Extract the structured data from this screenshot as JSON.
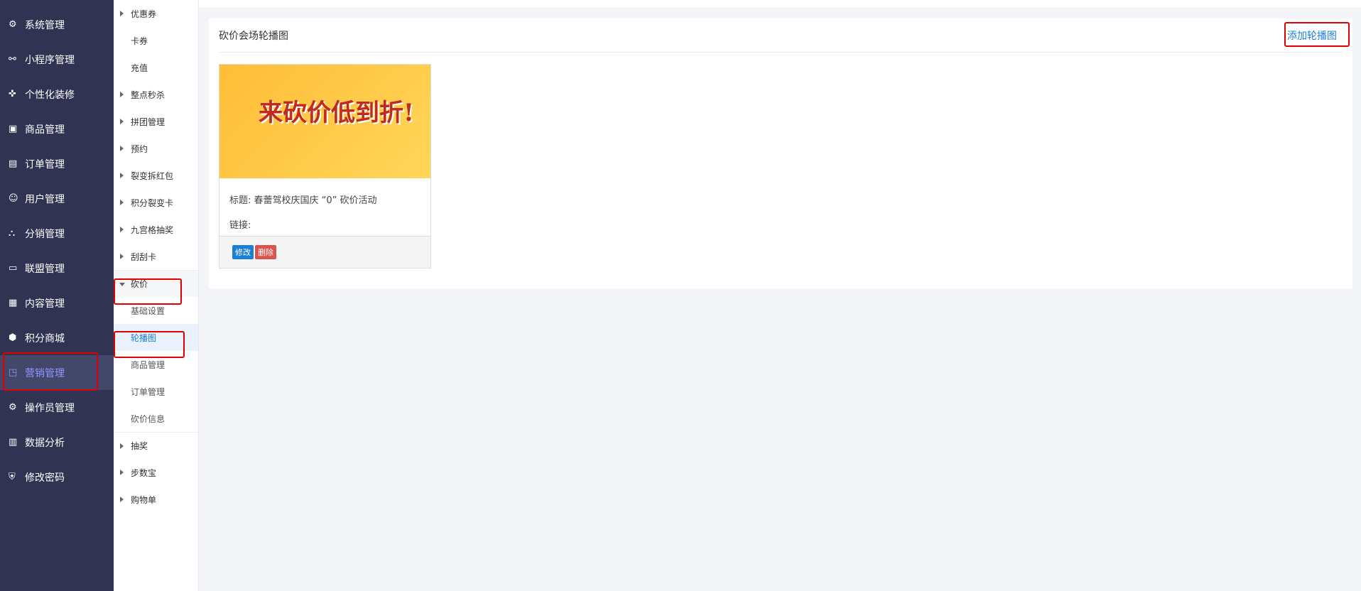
{
  "nav": [
    {
      "icon": "⚙",
      "label": "系统管理"
    },
    {
      "icon": "⚯",
      "label": "小程序管理"
    },
    {
      "icon": "✜",
      "label": "个性化装修"
    },
    {
      "icon": "▣",
      "label": "商品管理"
    },
    {
      "icon": "▤",
      "label": "订单管理"
    },
    {
      "icon": "☺",
      "label": "用户管理"
    },
    {
      "icon": "⛬",
      "label": "分销管理"
    },
    {
      "icon": "▭",
      "label": "联盟管理"
    },
    {
      "icon": "▦",
      "label": "内容管理"
    },
    {
      "icon": "⬢",
      "label": "积分商城"
    },
    {
      "icon": "◳",
      "label": "营销管理",
      "active": true
    },
    {
      "icon": "⚙",
      "label": "操作员管理"
    },
    {
      "icon": "▥",
      "label": "数据分析"
    },
    {
      "icon": "⛨",
      "label": "修改密码"
    }
  ],
  "sub": [
    {
      "l": "优惠券",
      "a": 1
    },
    {
      "l": "卡券"
    },
    {
      "l": "充值"
    },
    {
      "l": "整点秒杀",
      "a": 1
    },
    {
      "l": "拼团管理",
      "a": 1
    },
    {
      "l": "预约",
      "a": 1
    },
    {
      "l": "裂变拆红包",
      "a": 1
    },
    {
      "l": "积分裂变卡",
      "a": 1
    },
    {
      "l": "九宫格抽奖",
      "a": 1
    },
    {
      "l": "刮刮卡",
      "a": 1
    },
    {
      "l": "砍价",
      "a": 2
    },
    {
      "l": "基础设置",
      "c": 1
    },
    {
      "l": "轮播图",
      "c": 1,
      "h": 1
    },
    {
      "l": "商品管理",
      "c": 1
    },
    {
      "l": "订单管理",
      "c": 1
    },
    {
      "l": "砍价信息",
      "c": 1
    },
    {
      "l": "抽奖",
      "a": 1
    },
    {
      "l": "步数宝",
      "a": 1
    },
    {
      "l": "购物单",
      "a": 1
    }
  ],
  "panel": {
    "title": "砍价会场轮播图",
    "add": "添加轮播图"
  },
  "card": {
    "banner": "来砍价低到折!",
    "title_label": "标题:",
    "title": "春蕾驾校庆国庆 “0” 砍价活动",
    "link_label": "链接:",
    "link": "",
    "edit": "修改",
    "del": "删除"
  }
}
